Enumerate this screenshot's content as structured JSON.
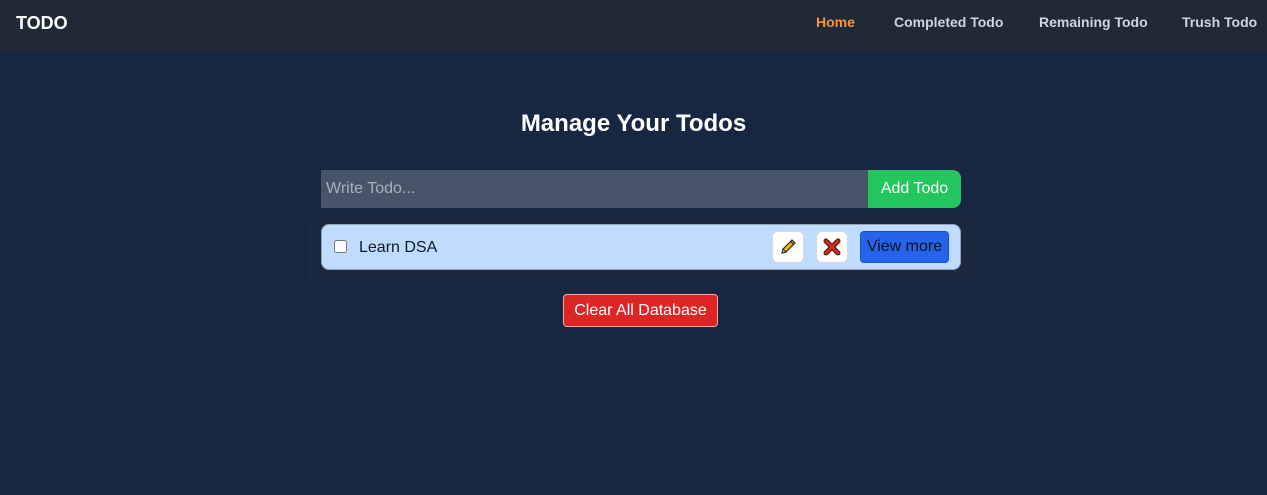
{
  "nav": {
    "brand": "TODO",
    "links": [
      {
        "label": "Home",
        "active": true
      },
      {
        "label": "Completed Todo",
        "active": false
      },
      {
        "label": "Remaining Todo",
        "active": false
      },
      {
        "label": "Trush Todo",
        "active": false
      }
    ]
  },
  "main": {
    "title": "Manage Your Todos",
    "input": {
      "value": "",
      "placeholder": "Write Todo..."
    },
    "add_label": "Add Todo",
    "todos": [
      {
        "text": "Learn DSA",
        "checked": false,
        "edit_icon": "pencil-icon",
        "delete_icon": "cross-icon",
        "view_label": "View more"
      }
    ],
    "clear_label": "Clear All Database"
  },
  "colors": {
    "background": "#172741",
    "navbar": "#1f2937",
    "active_link": "#fb923c",
    "add_button": "#22c55e",
    "todo_item": "#bfdbfe",
    "view_button": "#2563eb",
    "clear_button": "#dc2626"
  }
}
